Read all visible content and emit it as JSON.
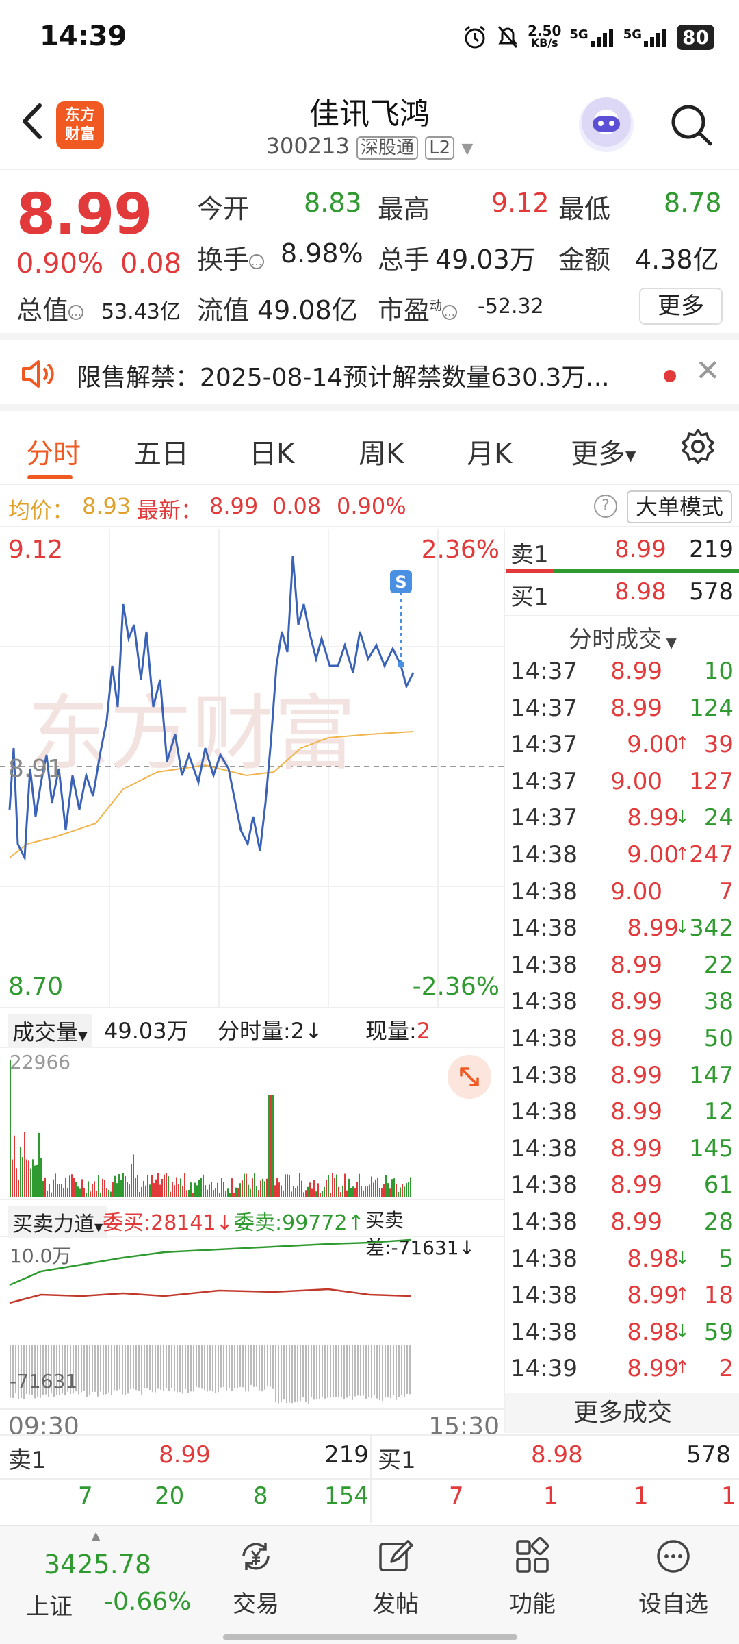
{
  "status": {
    "time": "14:39",
    "speed": "2.50",
    "speed_unit": "KB/s",
    "net1": "5G",
    "net2": "5G",
    "battery": "80"
  },
  "header": {
    "name": "佳讯飞鸿",
    "code": "300213",
    "tag1": "深股通",
    "tag2": "L2",
    "logo_line1": "东方",
    "logo_line2": "财富"
  },
  "quote": {
    "price": "8.99",
    "pct": "0.90%",
    "chg": "0.08",
    "open_label": "今开",
    "open": "8.83",
    "high_label": "最高",
    "high": "9.12",
    "low_label": "最低",
    "low": "8.78",
    "turnover_label": "换手",
    "turnover": "8.98%",
    "volume_label": "总手",
    "volume": "49.03万",
    "amount_label": "金额",
    "amount": "4.38亿",
    "mktcap_label": "总值",
    "mktcap": "53.43亿",
    "float_label": "流值",
    "float": "49.08亿",
    "pe_label": "市盈",
    "pe_sup": "动",
    "pe": "-52.32",
    "more": "更多"
  },
  "notice": {
    "text": "限售解禁：2025-08-14预计解禁数量630.3万..."
  },
  "tabs": [
    "分时",
    "五日",
    "日K",
    "周K",
    "月K",
    "更多"
  ],
  "avg": {
    "label": "均价：",
    "value": "8.93",
    "latest_label": "最新：",
    "latest": "8.99",
    "chg": "0.08",
    "pct": "0.90%",
    "help": "?",
    "big_mode": "大单模式"
  },
  "chart": {
    "ymax": "9.12",
    "ymin": "8.70",
    "pmax": "2.36%",
    "pmin": "-2.36%",
    "mid": "8.91",
    "t_start": "09:30",
    "t_end": "15:30",
    "marker": "S"
  },
  "volume": {
    "label": "成交量",
    "total": "49.03万",
    "minute_label": "分时量:",
    "minute": "2",
    "minute_arrow": "↓",
    "now_label": "现量:",
    "now": "2",
    "peak": "22966"
  },
  "power": {
    "label": "买卖力道",
    "buy_label": "委买:",
    "buy": "28141",
    "buy_arrow": "↓",
    "sell_label": "委卖:",
    "sell": "99772",
    "sell_arrow": "↑",
    "diff_label": "买卖差:",
    "diff": "-71631",
    "diff_arrow": "↓",
    "top": "10.0万",
    "bottom": "-71631"
  },
  "orderbook_side": {
    "sell_label": "卖1",
    "sell_price": "8.99",
    "sell_vol": "219",
    "buy_label": "买1",
    "buy_price": "8.98",
    "buy_vol": "578"
  },
  "trades_title": "分时成交",
  "trades": [
    {
      "time": "14:37",
      "price": "8.99",
      "dir": "",
      "vol": "10",
      "pc": "red",
      "vc": "green"
    },
    {
      "time": "14:37",
      "price": "8.99",
      "dir": "",
      "vol": "124",
      "pc": "red",
      "vc": "green"
    },
    {
      "time": "14:37",
      "price": "9.00",
      "dir": "↑",
      "vol": "39",
      "pc": "red",
      "vc": "red"
    },
    {
      "time": "14:37",
      "price": "9.00",
      "dir": "",
      "vol": "127",
      "pc": "red",
      "vc": "red"
    },
    {
      "time": "14:37",
      "price": "8.99",
      "dir": "↓",
      "vol": "24",
      "pc": "red",
      "vc": "green"
    },
    {
      "time": "14:38",
      "price": "9.00",
      "dir": "↑",
      "vol": "247",
      "pc": "red",
      "vc": "red"
    },
    {
      "time": "14:38",
      "price": "9.00",
      "dir": "",
      "vol": "7",
      "pc": "red",
      "vc": "red"
    },
    {
      "time": "14:38",
      "price": "8.99",
      "dir": "↓",
      "vol": "342",
      "pc": "red",
      "vc": "green"
    },
    {
      "time": "14:38",
      "price": "8.99",
      "dir": "",
      "vol": "22",
      "pc": "red",
      "vc": "green"
    },
    {
      "time": "14:38",
      "price": "8.99",
      "dir": "",
      "vol": "38",
      "pc": "red",
      "vc": "green"
    },
    {
      "time": "14:38",
      "price": "8.99",
      "dir": "",
      "vol": "50",
      "pc": "red",
      "vc": "green"
    },
    {
      "time": "14:38",
      "price": "8.99",
      "dir": "",
      "vol": "147",
      "pc": "red",
      "vc": "green"
    },
    {
      "time": "14:38",
      "price": "8.99",
      "dir": "",
      "vol": "12",
      "pc": "red",
      "vc": "green"
    },
    {
      "time": "14:38",
      "price": "8.99",
      "dir": "",
      "vol": "145",
      "pc": "red",
      "vc": "green"
    },
    {
      "time": "14:38",
      "price": "8.99",
      "dir": "",
      "vol": "61",
      "pc": "red",
      "vc": "green"
    },
    {
      "time": "14:38",
      "price": "8.99",
      "dir": "",
      "vol": "28",
      "pc": "red",
      "vc": "green"
    },
    {
      "time": "14:38",
      "price": "8.98",
      "dir": "↓",
      "vol": "5",
      "pc": "red",
      "vc": "green"
    },
    {
      "time": "14:38",
      "price": "8.99",
      "dir": "↑",
      "vol": "18",
      "pc": "red",
      "vc": "red"
    },
    {
      "time": "14:38",
      "price": "8.98",
      "dir": "↓",
      "vol": "59",
      "pc": "red",
      "vc": "green"
    },
    {
      "time": "14:39",
      "price": "8.99",
      "dir": "↑",
      "vol": "2",
      "pc": "red",
      "vc": "red"
    }
  ],
  "more_trades": "更多成交",
  "book": {
    "sell_label": "卖1",
    "sell_price": "8.99",
    "sell_vol": "219",
    "buy_label": "买1",
    "buy_price": "8.98",
    "buy_vol": "578",
    "sell_queue": [
      "7",
      "20",
      "8",
      "154"
    ],
    "buy_queue": [
      "7",
      "1",
      "1",
      "1"
    ]
  },
  "bottomnav": {
    "index_value": "3425.78",
    "index_name": "上证",
    "index_pct": "-0.66%",
    "trade": "交易",
    "post": "发帖",
    "func": "功能",
    "watch": "设自选"
  },
  "colors": {
    "up": "#e23a3a",
    "down": "#2f9a2f",
    "accent": "#f05a22",
    "price_line": "#3a63b8",
    "avg_line": "#f0b44a"
  }
}
